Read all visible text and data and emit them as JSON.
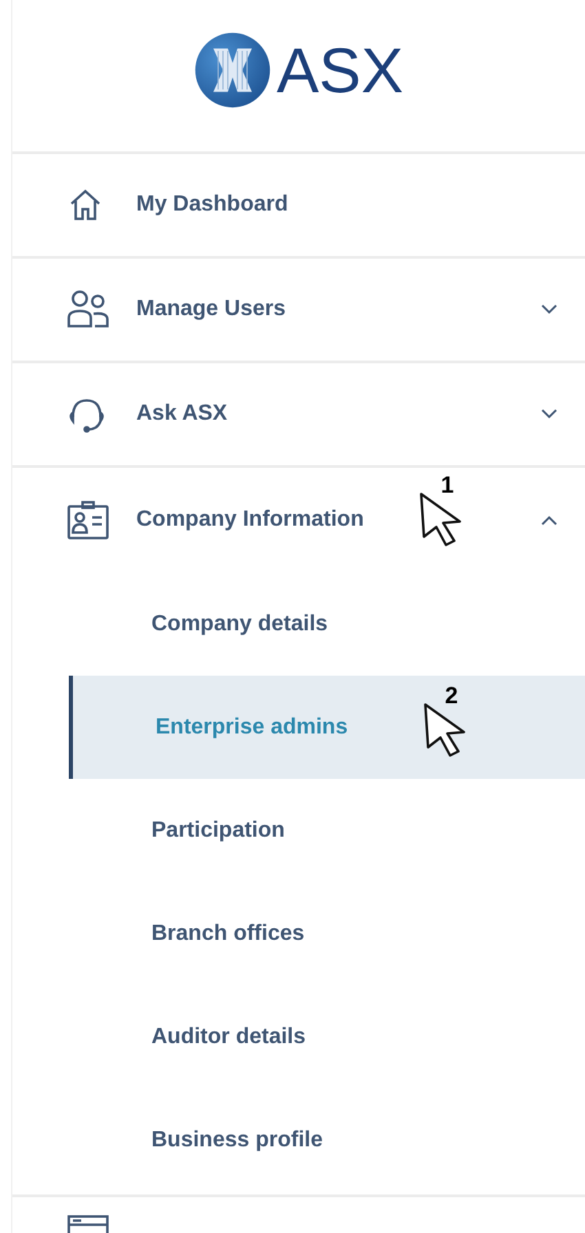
{
  "logo": {
    "text": "ASX"
  },
  "nav": [
    {
      "label": "My Dashboard",
      "expandable": false,
      "expanded": false
    },
    {
      "label": "Manage Users",
      "expandable": true,
      "expanded": false
    },
    {
      "label": "Ask ASX",
      "expandable": true,
      "expanded": false
    },
    {
      "label": "Company Information",
      "expandable": true,
      "expanded": true,
      "marker": "1",
      "children": [
        {
          "label": "Company details",
          "selected": false
        },
        {
          "label": "Enterprise admins",
          "selected": true,
          "marker": "2"
        },
        {
          "label": "Participation",
          "selected": false
        },
        {
          "label": "Branch offices",
          "selected": false
        },
        {
          "label": "Auditor details",
          "selected": false
        },
        {
          "label": "Business profile",
          "selected": false
        }
      ]
    },
    {
      "expandable": false,
      "expanded": false
    }
  ]
}
